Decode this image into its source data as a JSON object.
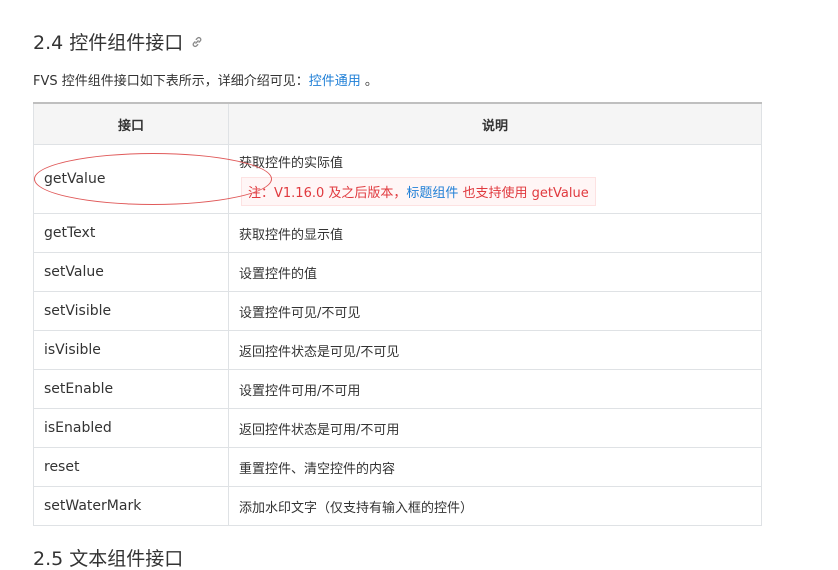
{
  "heading": {
    "title": "2.4 控件组件接口"
  },
  "intro": {
    "prefix": "FVS 控件组件接口如下表所示，详细介绍可见：",
    "link": "控件通用",
    "suffix": " 。"
  },
  "table": {
    "headers": [
      "接口",
      "说明"
    ],
    "rows": [
      {
        "name": "getValue",
        "desc": "获取控件的实际值"
      },
      {
        "name": "getText",
        "desc": "获取控件的显示值"
      },
      {
        "name": "setValue",
        "desc": "设置控件的值"
      },
      {
        "name": "setVisible",
        "desc": "设置控件可见/不可见"
      },
      {
        "name": "isVisible",
        "desc": "返回控件状态是可见/不可见"
      },
      {
        "name": "setEnable",
        "desc": "设置控件可用/不可用"
      },
      {
        "name": "isEnabled",
        "desc": "返回控件状态是可用/不可用"
      },
      {
        "name": "reset",
        "desc": "重置控件、清空控件的内容"
      },
      {
        "name": "setWaterMark",
        "desc": "添加水印文字（仅支持有输入框的控件）"
      }
    ],
    "note": {
      "prefix": "注：V1.16.0 及之后版本，",
      "link": "标题组件",
      "suffix": " 也支持使用 getValue"
    }
  },
  "next_heading": "2.5 文本组件接口",
  "colors": {
    "link": "#1f7fd6",
    "note_text": "#e0393e",
    "note_bg": "#fff6f6",
    "annotation": "#e05a5a"
  }
}
